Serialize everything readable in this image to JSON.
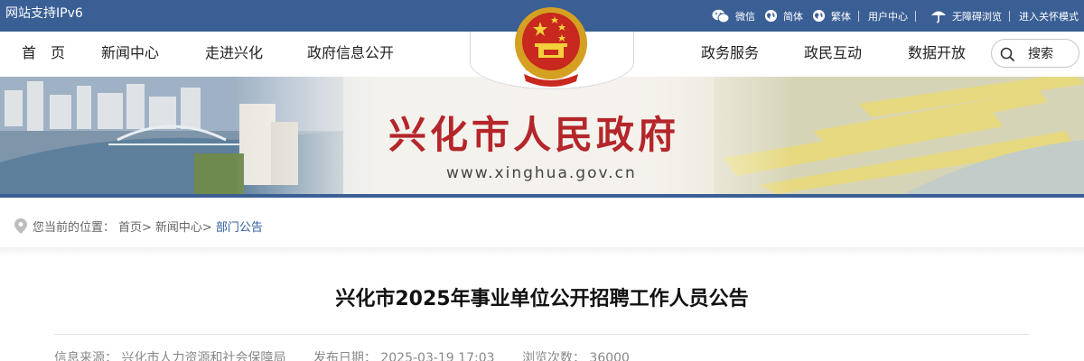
{
  "topbar": {
    "ipv6": "网站支持IPv6",
    "wechat": "微信",
    "simplified": "简体",
    "traditional": "繁体",
    "user_center": "用户中心",
    "accessible": "无障碍浏览",
    "care_mode": "进入关怀模式"
  },
  "nav": {
    "home": "首　页",
    "news": "新闻中心",
    "about": "走进兴化",
    "info": "政府信息公开",
    "services": "政务服务",
    "interaction": "政民互动",
    "open_data": "数据开放",
    "search_label": "搜索"
  },
  "banner": {
    "title": "兴化市人民政府",
    "url": "www.xinghua.gov.cn"
  },
  "breadcrumb": {
    "prefix": "您当前的位置：",
    "home": "首页>",
    "news": "新闻中心>",
    "current": "部门公告"
  },
  "article": {
    "title": "兴化市2025年事业单位公开招聘工作人员公告",
    "source": "信息来源：  兴化市人力资源和社会保障局",
    "date": "发布日期：  2025-03-19 17:03",
    "views": "浏览次数：  36000"
  },
  "colors": {
    "topbar": "#3a5f95",
    "title_red": "#b4262a",
    "link_blue": "#2d5f9e"
  },
  "icons": [
    "wechat-icon",
    "globe-icon",
    "umbrella-icon",
    "search-icon",
    "location-pin-icon",
    "national-emblem"
  ]
}
